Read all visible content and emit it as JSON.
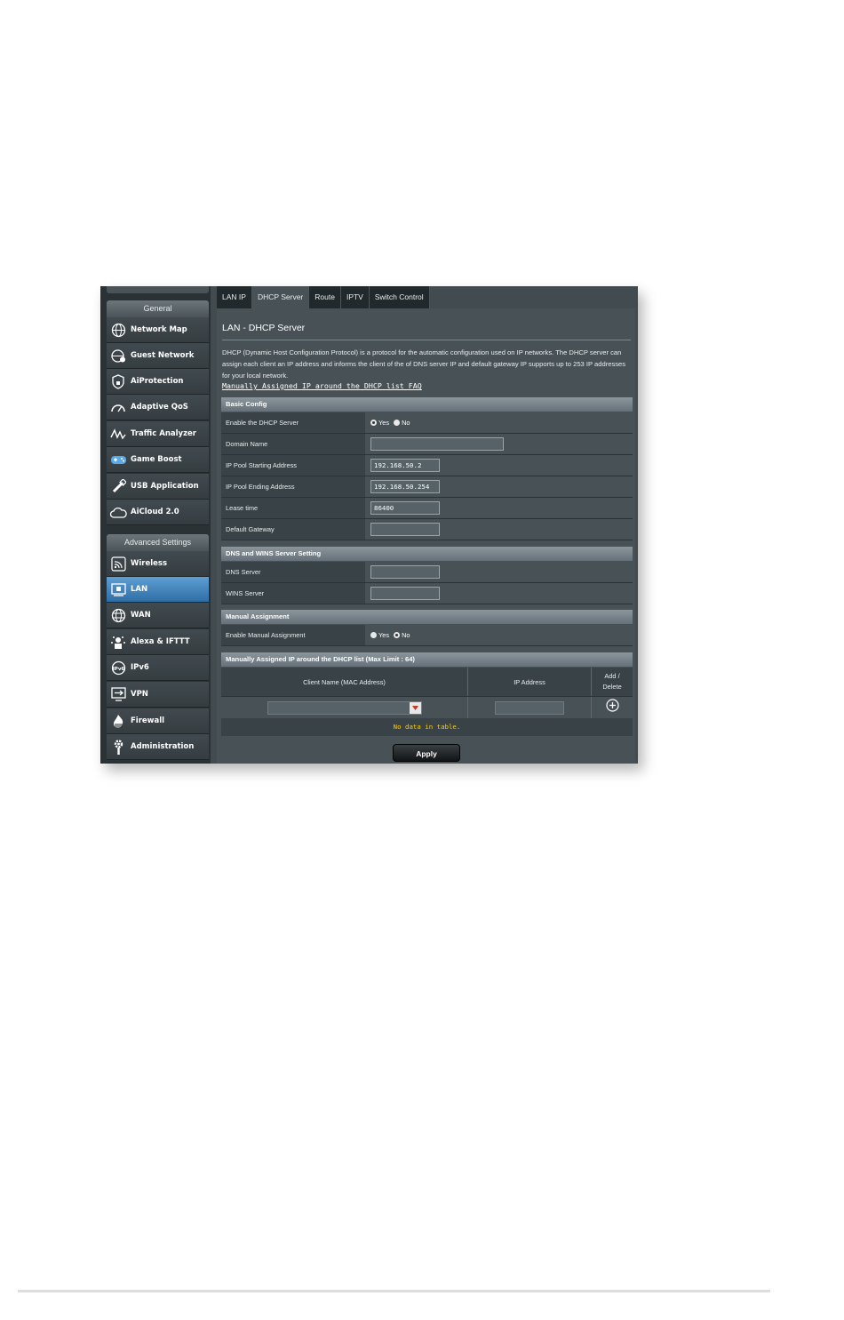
{
  "sidebar": {
    "general_header": "General",
    "general_items": [
      {
        "label": "Network Map",
        "icon": "network-map-icon"
      },
      {
        "label": "Guest Network",
        "icon": "guest-network-icon"
      },
      {
        "label": "AiProtection",
        "icon": "aiprotection-icon"
      },
      {
        "label": "Adaptive QoS",
        "icon": "adaptive-qos-icon"
      },
      {
        "label": "Traffic Analyzer",
        "icon": "traffic-analyzer-icon"
      },
      {
        "label": "Game Boost",
        "icon": "game-boost-icon"
      },
      {
        "label": "USB Application",
        "icon": "usb-application-icon"
      },
      {
        "label": "AiCloud 2.0",
        "icon": "aicloud-icon"
      }
    ],
    "advanced_header": "Advanced Settings",
    "advanced_items": [
      {
        "label": "Wireless",
        "icon": "wireless-icon"
      },
      {
        "label": "LAN",
        "icon": "lan-icon",
        "active": true
      },
      {
        "label": "WAN",
        "icon": "wan-icon"
      },
      {
        "label": "Alexa & IFTTT",
        "icon": "alexa-ifttt-icon"
      },
      {
        "label": "IPv6",
        "icon": "ipv6-icon"
      },
      {
        "label": "VPN",
        "icon": "vpn-icon"
      },
      {
        "label": "Firewall",
        "icon": "firewall-icon"
      },
      {
        "label": "Administration",
        "icon": "administration-icon"
      }
    ]
  },
  "tabs": [
    {
      "label": "LAN IP"
    },
    {
      "label": "DHCP Server",
      "active": true
    },
    {
      "label": "Route"
    },
    {
      "label": "IPTV"
    },
    {
      "label": "Switch Control"
    }
  ],
  "page": {
    "title": "LAN - DHCP Server",
    "description": "DHCP (Dynamic Host Configuration Protocol) is a protocol for the automatic configuration used on IP networks. The DHCP server can assign each client an IP address and informs the client of the of DNS server IP and default gateway IP supports up to 253 IP addresses for your local network.",
    "faq_link": "Manually Assigned IP around the DHCP list FAQ"
  },
  "basic_config": {
    "header": "Basic Config",
    "enable_label": "Enable the DHCP Server",
    "yes": "Yes",
    "no": "No",
    "enabled": "Yes",
    "domain_label": "Domain Name",
    "domain_value": "",
    "start_label": "IP Pool Starting Address",
    "start_value": "192.168.50.2",
    "end_label": "IP Pool Ending Address",
    "end_value": "192.168.50.254",
    "lease_label": "Lease time",
    "lease_value": "86400",
    "gateway_label": "Default Gateway",
    "gateway_value": ""
  },
  "dns": {
    "header": "DNS and WINS Server Setting",
    "dns_label": "DNS Server",
    "dns_value": "",
    "wins_label": "WINS Server",
    "wins_value": ""
  },
  "manual": {
    "header": "Manual Assignment",
    "enable_label": "Enable Manual Assignment",
    "yes": "Yes",
    "no": "No",
    "enabled": "No"
  },
  "list": {
    "header": "Manually Assigned IP around the DHCP list (Max Limit : 64)",
    "col_client": "Client Name (MAC Address)",
    "col_ip": "IP Address",
    "col_add": "Add / Delete",
    "empty": "No data in table."
  },
  "apply_label": "Apply",
  "colors": {
    "accent": "#3a7fbf",
    "panel": "#475156",
    "warn": "#ffcc00"
  }
}
